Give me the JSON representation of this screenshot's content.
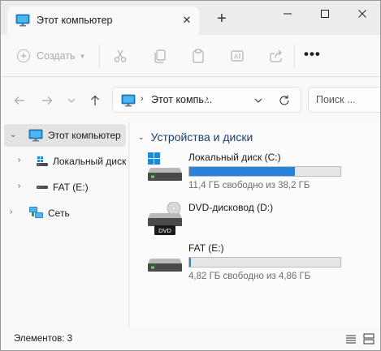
{
  "window": {
    "tab_title": "Этот компьютер",
    "tab_close_glyph": "✕",
    "new_tab_glyph": "+",
    "controls": {
      "minimize": "minimize-icon",
      "maximize": "maximize-icon",
      "close": "close-icon"
    }
  },
  "toolbar": {
    "create_label": "Создать",
    "create_icon": "plus-circle-icon",
    "buttons": [
      "cut-icon",
      "copy-icon",
      "paste-icon",
      "rename-icon",
      "share-icon"
    ],
    "more_label": "•••"
  },
  "navigation": {
    "back_icon": "arrow-left-icon",
    "forward_icon": "arrow-right-icon",
    "recent_icon": "chevron-down-icon",
    "up_icon": "arrow-up-icon",
    "address_text": "Этот компь...",
    "search_placeholder": "Поиск ..."
  },
  "sidebar": {
    "items": [
      {
        "label": "Этот компьютер",
        "icon": "monitor-icon",
        "selected": true
      },
      {
        "label": "Локальный диск",
        "icon": "local-disk-icon",
        "selected": false
      },
      {
        "label": "FAT (E:)",
        "icon": "drive-icon",
        "selected": false
      },
      {
        "label": "Сеть",
        "icon": "network-icon",
        "selected": false
      }
    ]
  },
  "content": {
    "section_title": "Устройства и диски",
    "drives": [
      {
        "name": "Локальный диск (C:)",
        "free_text": "11,4 ГБ свободно из 38,2 ГБ",
        "used_fraction": 0.7,
        "icon": "windows-drive-icon"
      },
      {
        "name": "DVD-дисковод (D:)",
        "badge": "DVD",
        "icon": "dvd-drive-icon"
      },
      {
        "name": "FAT (E:)",
        "free_text": "4,82 ГБ свободно из 4,86 ГБ",
        "used_fraction": 0.01,
        "icon": "drive-icon"
      }
    ]
  },
  "status": {
    "items_text": "Элементов: 3",
    "view_details_icon": "details-view-icon",
    "view_tiles_icon": "tiles-view-icon"
  },
  "colors": {
    "accent": "#2b82d9",
    "section_title": "#1f3f6b",
    "selected_bg": "#e3e3e3"
  }
}
